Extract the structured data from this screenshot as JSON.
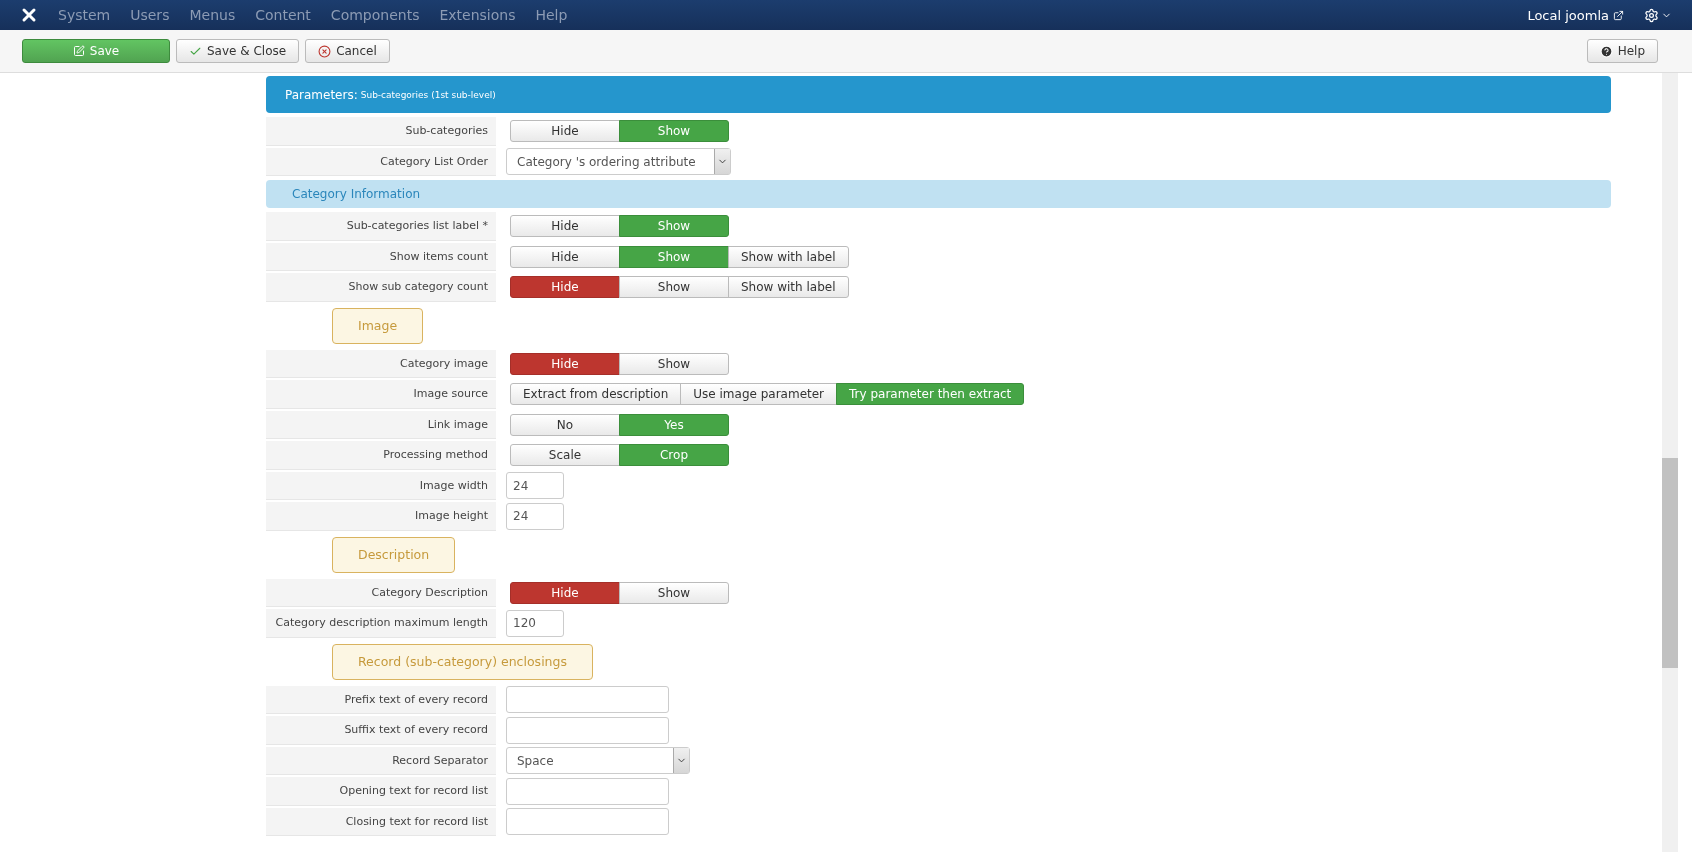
{
  "navbar": {
    "menu": [
      "System",
      "Users",
      "Menus",
      "Content",
      "Components",
      "Extensions",
      "Help"
    ],
    "site_link": "Local joomla"
  },
  "toolbar": {
    "buttons": [
      {
        "label": "Save",
        "kind": "save"
      },
      {
        "label": "Save & Close",
        "kind": "close"
      },
      {
        "label": "Cancel",
        "kind": "cancel"
      }
    ],
    "help": "Help"
  },
  "header": {
    "title": "Parameters:",
    "subtitle": "Sub-categories (1st sub-level)"
  },
  "form": [
    {
      "kind": "toggle",
      "label": "Sub-categories",
      "options": [
        {
          "label": "Hide",
          "selected": false
        },
        {
          "label": "Show",
          "kind": "positive",
          "selected": true
        }
      ]
    },
    {
      "kind": "select",
      "label": "Category List Order",
      "value": "Category 's ordering attribute"
    },
    {
      "kind": "section",
      "label": "Category Information"
    },
    {
      "kind": "toggle",
      "label": "Sub-categories list label *",
      "options": [
        {
          "label": "Hide",
          "selected": false
        },
        {
          "label": "Show",
          "kind": "positive",
          "selected": true
        }
      ]
    },
    {
      "kind": "toggle",
      "label": "Show items count",
      "options": [
        {
          "label": "Hide",
          "selected": false
        },
        {
          "label": "Show",
          "kind": "positive",
          "selected": true
        },
        {
          "label": "Show with label",
          "selected": false
        }
      ]
    },
    {
      "kind": "toggle",
      "label": "Show sub category count",
      "options": [
        {
          "label": "Hide",
          "kind": "negative",
          "selected": true
        },
        {
          "label": "Show",
          "selected": false
        },
        {
          "label": "Show with label",
          "selected": false
        }
      ]
    },
    {
      "kind": "legend",
      "label": "Image"
    },
    {
      "kind": "toggle",
      "label": "Category image",
      "options": [
        {
          "label": "Hide",
          "kind": "negative",
          "selected": true
        },
        {
          "label": "Show",
          "selected": false
        }
      ]
    },
    {
      "kind": "toggle",
      "label": "Image source",
      "options": [
        {
          "label": "Extract from description",
          "selected": false
        },
        {
          "label": "Use image parameter",
          "selected": false
        },
        {
          "label": "Try parameter then extract",
          "kind": "positive",
          "selected": true
        }
      ]
    },
    {
      "kind": "toggle",
      "label": "Link image",
      "options": [
        {
          "label": "No",
          "selected": false
        },
        {
          "label": "Yes",
          "kind": "positive",
          "selected": true
        }
      ]
    },
    {
      "kind": "toggle",
      "label": "Processing method",
      "options": [
        {
          "label": "Scale",
          "selected": false
        },
        {
          "label": "Crop",
          "kind": "positive",
          "selected": true
        }
      ]
    },
    {
      "kind": "number",
      "label": "Image width",
      "value": "24"
    },
    {
      "kind": "number",
      "label": "Image height",
      "value": "24"
    },
    {
      "kind": "legend",
      "label": "Description"
    },
    {
      "kind": "toggle",
      "label": "Category Description",
      "options": [
        {
          "label": "Hide",
          "kind": "negative",
          "selected": true
        },
        {
          "label": "Show",
          "selected": false
        }
      ]
    },
    {
      "kind": "number",
      "label": "Category description maximum length",
      "value": "120"
    },
    {
      "kind": "legend",
      "label": "Record (sub-category) enclosings"
    },
    {
      "kind": "text",
      "label": "Prefix text of every record"
    },
    {
      "kind": "text",
      "label": "Suffix text of every record"
    },
    {
      "kind": "select",
      "label": "Record Separator",
      "value": "Space"
    },
    {
      "kind": "text",
      "label": "Opening text for record list"
    },
    {
      "kind": "text",
      "label": "Closing text for record list"
    }
  ]
}
